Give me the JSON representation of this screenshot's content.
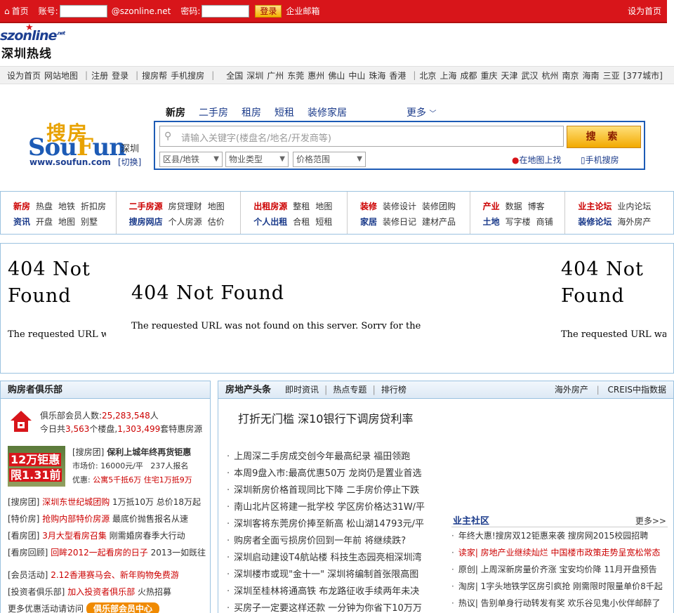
{
  "topbar": {
    "home": "首页",
    "account_label": "账号:",
    "domain": "@szonline.net",
    "password_label": "密码:",
    "login": "登录",
    "mail": "企业邮箱",
    "set_home": "设为首页"
  },
  "logo": {
    "en": "szonline",
    "sup": ".net",
    "cn": "深圳热线"
  },
  "citynav": {
    "links": [
      "设为首页",
      "网站地图"
    ],
    "account": [
      "注册",
      "登录"
    ],
    "tools": [
      "搜房帮",
      "手机搜房"
    ],
    "south": [
      "全国",
      "深圳",
      "广州",
      "东莞",
      "惠州",
      "佛山",
      "中山",
      "珠海",
      "香港"
    ],
    "cities": [
      "北京",
      "上海",
      "成都",
      "重庆",
      "天津",
      "武汉",
      "杭州",
      "南京",
      "海南",
      "三亚"
    ],
    "count": "[377城市]"
  },
  "soufun": {
    "cn": "搜房",
    "en": "SouFun",
    "url": "www.soufun.com",
    "city": "深圳",
    "switch": "[切换]"
  },
  "search": {
    "tabs": [
      "新房",
      "二手房",
      "租房",
      "短租",
      "装修家居"
    ],
    "more": "更多",
    "placeholder": "请输入关键字(楼盘名/地名/开发商等)",
    "button": "搜 索",
    "selects": [
      "区县/地铁",
      "物业类型",
      "价格范围"
    ],
    "map": "在地图上找",
    "mobile": "手机搜房"
  },
  "channels": [
    [
      [
        "新房",
        "热盘",
        "地铁",
        "折扣房"
      ],
      [
        "资讯",
        "开盘",
        "地图",
        "别墅"
      ]
    ],
    [
      [
        "二手房源",
        "房贷理财",
        "地图"
      ],
      [
        "搜房网店",
        "个人房源",
        "估价"
      ]
    ],
    [
      [
        "出租房源",
        "整租",
        "地图"
      ],
      [
        "个人出租",
        "合租",
        "短租"
      ]
    ],
    [
      [
        "装修",
        "装修设计",
        "装修团购"
      ],
      [
        "家居",
        "装修日记",
        "建材产品"
      ]
    ],
    [
      [
        "产业",
        "数据",
        "博客"
      ],
      [
        "土地",
        "写字楼",
        "商铺"
      ]
    ],
    [
      [
        "业主论坛",
        "业内论坛"
      ],
      [
        "装修论坛",
        "海外房产"
      ]
    ]
  ],
  "banner": {
    "heading": "404 Not Found",
    "text": "The requested URL was not found on this server. Sorry for the"
  },
  "club": {
    "title": "购房者俱乐部",
    "members_label": "俱乐部会员人数:",
    "members": "25,283,548",
    "members_unit": "人",
    "today_pre": "今日共",
    "today_count": "3,563",
    "today_mid": "个楼盘,",
    "today_sets": "1,303,499",
    "today_post": "套特惠房源",
    "promo_line1": "12万钜惠",
    "promo_line2": "限1.31前",
    "deal_tag": "[搜房团]",
    "deal_title": "保利上城年终再货钜惠",
    "deal_price": "市场价: 16000元/平",
    "deal_signups": "237人报名",
    "deal_offer_label": "优惠:",
    "deal_offer": "公寓5千抵6万 住宅1万抵9万",
    "list": [
      {
        "tag": "[搜房团]",
        "red": "深圳东世纪城团购",
        "rest": "1万抵10万 总价18万起"
      },
      {
        "tag": "[特价房]",
        "red": "抢购内部特价房源",
        "rest": "最底价抛售报名从速"
      },
      {
        "tag": "[看房团]",
        "red": "3月大型看房召集",
        "rest": "刚需婚房春季大行动"
      },
      {
        "tag": "[看房回顾]",
        "red": "回眸2012一起看房的日子",
        "rest": "2013一如既往"
      },
      {
        "tag": "[会员活动]",
        "red": "2.12香港赛马会、新年购物免费游",
        "rest": ""
      },
      {
        "tag": "[投资者俱乐部]",
        "red": "加入投资者俱乐部",
        "rest": "火热招募"
      }
    ],
    "more_text": "更多优惠活动请访问",
    "center_btn": "俱乐部会员中心"
  },
  "news": {
    "title": "房地产头条",
    "tabs": [
      "即时资讯",
      "热点专题",
      "排行榜"
    ],
    "right": [
      "海外房产",
      "CREIS中指数据"
    ],
    "headline": "打折无门槛 深10银行下调房贷利率",
    "list": [
      "上周深二手房成交创今年最高纪录 福田领跑",
      "本周9盘入市:最高优惠50万 龙岗仍是置业首选",
      "深圳新房价格首现同比下降 二手房价停止下跌",
      "南山北片区将建一批学校 学区房价格达31W/平",
      "深圳客将东莞房价捧至新高 松山湖14793元/平",
      "购房者全面亏损房价回到一年前 将继续跌?",
      "深圳启动建设T4航站楼 科技生态园亮相深圳湾",
      "深圳楼市或现\"金十一\" 深圳将编制首张限高图",
      "深圳至桂林将通高铁 布龙路征收手续两年未决",
      "买房子一定要这样还款 一分钟为你省下10万万"
    ],
    "forum_title": "业主社区",
    "forum_more": "更多>>",
    "forum": [
      {
        "text": "年终大惠!搜房双12钜惠来袭 搜房网2015校园招聘",
        "red": false
      },
      {
        "text": "读家| 房地产业继续灿烂 中国楼市政策走势呈宽松常态",
        "red": true
      },
      {
        "text": "原创| 上周深新房量价齐涨 宝安均价降 11月开盘预告",
        "red": false
      },
      {
        "text": "淘房| 1字头地铁学区房引疯抢 刚需限时限量单价8千起",
        "red": false
      },
      {
        "text": "热议| 告别单身行动转发有奖 欢乐谷见鬼小伙伴邮醉了",
        "red": false
      }
    ]
  },
  "colors": {
    "brand_red": "#d8151a",
    "link_blue": "#1a3a8a",
    "border_blue": "#9bc2e0"
  }
}
